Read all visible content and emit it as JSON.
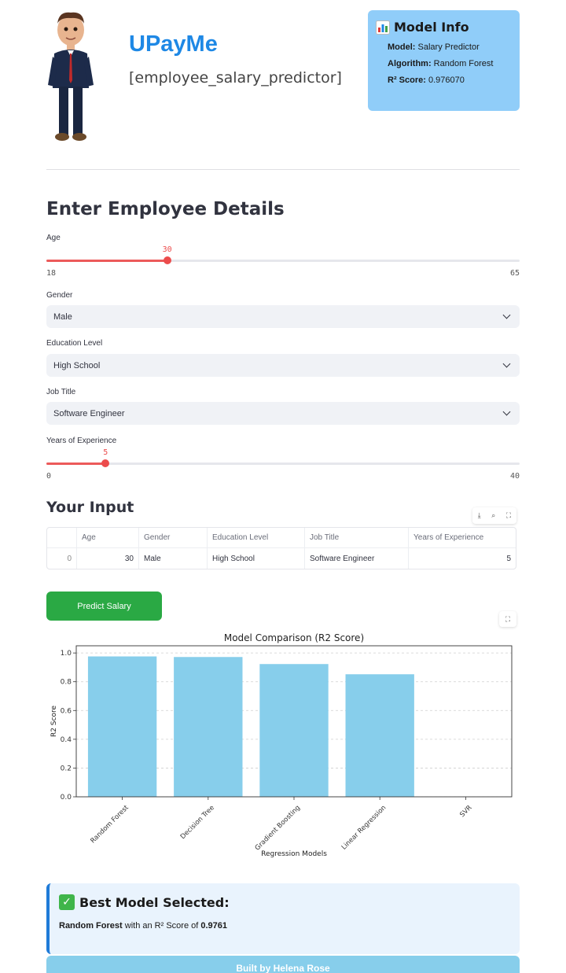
{
  "header": {
    "title": "UPayMe",
    "subtitle": "[employee_salary_predictor]"
  },
  "model_info": {
    "title": "Model Info",
    "icon": "bar-chart-icon",
    "model_label": "Model:",
    "model_value": "Salary Predictor",
    "algorithm_label": "Algorithm:",
    "algorithm_value": "Random Forest",
    "r2_label": "R² Score:",
    "r2_value": "0.976070"
  },
  "form": {
    "title": "Enter Employee Details",
    "age": {
      "label": "Age",
      "value": 30,
      "min": 18,
      "max": 65
    },
    "gender": {
      "label": "Gender",
      "value": "Male"
    },
    "education": {
      "label": "Education Level",
      "value": "High School"
    },
    "job_title": {
      "label": "Job Title",
      "value": "Software Engineer"
    },
    "experience": {
      "label": "Years of Experience",
      "value": 5,
      "min": 0,
      "max": 40
    }
  },
  "input_table": {
    "title": "Your Input",
    "columns": [
      "",
      "Age",
      "Gender",
      "Education Level",
      "Job Title",
      "Years of Experience"
    ],
    "rows": [
      [
        "0",
        "30",
        "Male",
        "High School",
        "Software Engineer",
        "5"
      ]
    ]
  },
  "predict_button": "Predict Salary",
  "chart_data": {
    "type": "bar",
    "title": "Model Comparison (R2 Score)",
    "xlabel": "Regression Models",
    "ylabel": "R2 Score",
    "categories": [
      "Random Forest",
      "Decision Tree",
      "Gradient Boosting",
      "Linear Regression",
      "SVR"
    ],
    "values": [
      0.976,
      0.972,
      0.923,
      0.852,
      0.0
    ],
    "ylim": [
      0,
      1.05
    ],
    "yticks": [
      "0.0",
      "0.2",
      "0.4",
      "0.6",
      "0.8",
      "1.0"
    ],
    "grid": "horizontal dashed",
    "color": "#87ceeb"
  },
  "best_model": {
    "title": "Best Model Selected:",
    "model": "Random Forest",
    "text": "with an R² Score of",
    "score": "0.9761"
  },
  "footer": "Built by Helena Rose",
  "colors": {
    "accent_blue": "#1e88e5",
    "info_box": "#90cdf9",
    "slider_red": "#ec4c4c",
    "button_green": "#2aa944"
  }
}
